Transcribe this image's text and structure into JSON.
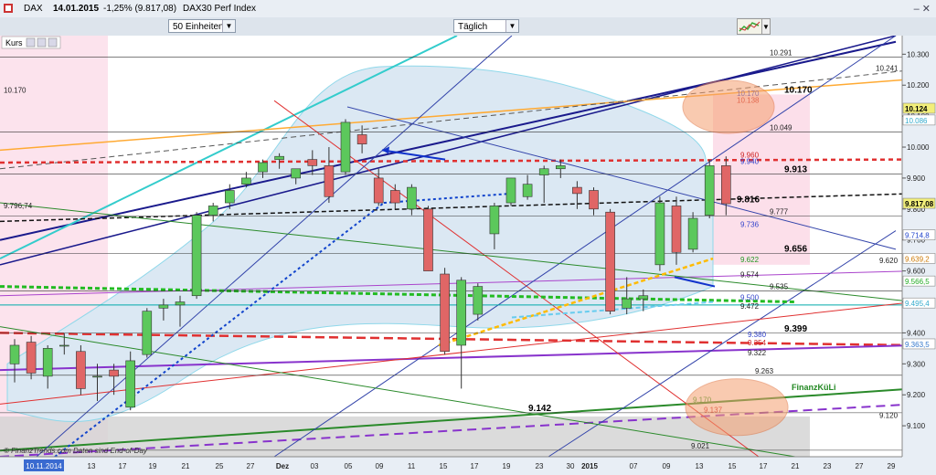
{
  "header": {
    "symbol": "DAX",
    "date": "14.01.2015",
    "change": "-1,25% (9.817,08)",
    "name": "DAX30 Perf Index",
    "window_controls": "– ✕"
  },
  "toolbar": {
    "units_value": "50 Einheiten",
    "period_value": "Täglich",
    "dropdown_arrow": "▼"
  },
  "panel": {
    "label": "Kurs"
  },
  "colors": {
    "up": "#5cc85c",
    "down": "#e06666",
    "price_box": "#f2ef7a",
    "band_fill": "#dbe8f3",
    "pink_zone": "#fbd7e5",
    "gray_zone": "#d2d2d2"
  },
  "chart_data": {
    "type": "candlestick",
    "y_axis": {
      "min": 9.0,
      "max": 10.36,
      "ticks": [
        "10.300",
        "10.200",
        "10.100",
        "10.000",
        "9.900",
        "9.800",
        "9.700",
        "9.600",
        "9.500",
        "9.400",
        "9.300",
        "9.200",
        "9.100"
      ]
    },
    "x_ticks": [
      "10.11.2014",
      "13",
      "17",
      "19",
      "21",
      "25",
      "27",
      "Dez",
      "03",
      "05",
      "09",
      "11",
      "15",
      "17",
      "19",
      "23",
      "30",
      "2015",
      "07",
      "09",
      "13",
      "15",
      "17",
      "21",
      "23",
      "27",
      "29"
    ],
    "candles": [
      {
        "date": "10.11.2014",
        "o": 9.3,
        "h": 9.38,
        "l": 9.24,
        "c": 9.36
      },
      {
        "date": "11.11.2014",
        "o": 9.37,
        "h": 9.39,
        "l": 9.25,
        "c": 9.27
      },
      {
        "date": "12.11.2014",
        "o": 9.26,
        "h": 9.36,
        "l": 9.22,
        "c": 9.35
      },
      {
        "date": "13.11.2014",
        "o": 9.36,
        "h": 9.4,
        "l": 9.33,
        "c": 9.36
      },
      {
        "date": "14.11.2014",
        "o": 9.34,
        "h": 9.36,
        "l": 9.2,
        "c": 9.22
      },
      {
        "date": "17.11.2014",
        "o": 9.26,
        "h": 9.3,
        "l": 9.18,
        "c": 9.26
      },
      {
        "date": "18.11.2014",
        "o": 9.28,
        "h": 9.3,
        "l": 9.2,
        "c": 9.26
      },
      {
        "date": "19.11.2014",
        "o": 9.16,
        "h": 9.34,
        "l": 9.15,
        "c": 9.31
      },
      {
        "date": "20.11.2014",
        "o": 9.33,
        "h": 9.48,
        "l": 9.32,
        "c": 9.47
      },
      {
        "date": "21.11.2014",
        "o": 9.48,
        "h": 9.51,
        "l": 9.44,
        "c": 9.49
      },
      {
        "date": "24.11.2014",
        "o": 9.49,
        "h": 9.52,
        "l": 9.42,
        "c": 9.5
      },
      {
        "date": "25.11.2014",
        "o": 9.52,
        "h": 9.79,
        "l": 9.51,
        "c": 9.78
      },
      {
        "date": "26.11.2014",
        "o": 9.78,
        "h": 9.82,
        "l": 9.76,
        "c": 9.81
      },
      {
        "date": "27.11.2014",
        "o": 9.82,
        "h": 9.88,
        "l": 9.8,
        "c": 9.86
      },
      {
        "date": "28.11.2014",
        "o": 9.88,
        "h": 9.92,
        "l": 9.87,
        "c": 9.9
      },
      {
        "date": "01.12.2014",
        "o": 9.92,
        "h": 9.96,
        "l": 9.9,
        "c": 9.95
      },
      {
        "date": "02.12.2014",
        "o": 9.96,
        "h": 9.98,
        "l": 9.93,
        "c": 9.97
      },
      {
        "date": "03.12.2014",
        "o": 9.9,
        "h": 9.93,
        "l": 9.88,
        "c": 9.93
      },
      {
        "date": "04.12.2014",
        "o": 9.96,
        "h": 9.99,
        "l": 9.91,
        "c": 9.94
      },
      {
        "date": "05.12.2014",
        "o": 9.94,
        "h": 10.0,
        "l": 9.82,
        "c": 9.84
      },
      {
        "date": "08.12.2014",
        "o": 9.92,
        "h": 10.09,
        "l": 9.91,
        "c": 10.08
      },
      {
        "date": "09.12.2014",
        "o": 10.04,
        "h": 10.07,
        "l": 9.98,
        "c": 10.01
      },
      {
        "date": "10.12.2014",
        "o": 9.9,
        "h": 9.93,
        "l": 9.81,
        "c": 9.82
      },
      {
        "date": "11.12.2014",
        "o": 9.86,
        "h": 9.88,
        "l": 9.8,
        "c": 9.82
      },
      {
        "date": "12.12.2014",
        "o": 9.8,
        "h": 9.88,
        "l": 9.78,
        "c": 9.87
      },
      {
        "date": "15.12.2014",
        "o": 9.8,
        "h": 9.81,
        "l": 9.6,
        "c": 9.6
      },
      {
        "date": "16.12.2014",
        "o": 9.59,
        "h": 9.61,
        "l": 9.33,
        "c": 9.34
      },
      {
        "date": "17.12.2014",
        "o": 9.36,
        "h": 9.58,
        "l": 9.22,
        "c": 9.57
      },
      {
        "date": "18.12.2014",
        "o": 9.46,
        "h": 9.56,
        "l": 9.44,
        "c": 9.55
      },
      {
        "date": "19.12.2014",
        "o": 9.72,
        "h": 9.82,
        "l": 9.67,
        "c": 9.81
      },
      {
        "date": "22.12.2014",
        "o": 9.82,
        "h": 9.9,
        "l": 9.81,
        "c": 9.9
      },
      {
        "date": "23.12.2014",
        "o": 9.84,
        "h": 9.91,
        "l": 9.83,
        "c": 9.88
      },
      {
        "date": "29.12.2014",
        "o": 9.91,
        "h": 9.94,
        "l": 9.82,
        "c": 9.93
      },
      {
        "date": "30.12.2014",
        "o": 9.93,
        "h": 9.96,
        "l": 9.9,
        "c": 9.94
      },
      {
        "date": "02.01.2015",
        "o": 9.87,
        "h": 9.89,
        "l": 9.8,
        "c": 9.85
      },
      {
        "date": "05.01.2015",
        "o": 9.86,
        "h": 9.87,
        "l": 9.78,
        "c": 9.8
      },
      {
        "date": "06.01.2015",
        "o": 9.79,
        "h": 9.8,
        "l": 9.46,
        "c": 9.47
      },
      {
        "date": "07.01.2015",
        "o": 9.48,
        "h": 9.58,
        "l": 9.46,
        "c": 9.51
      },
      {
        "date": "08.01.2015",
        "o": 9.51,
        "h": 9.54,
        "l": 9.47,
        "c": 9.52
      },
      {
        "date": "09.01.2015",
        "o": 9.62,
        "h": 9.84,
        "l": 9.6,
        "c": 9.82
      },
      {
        "date": "12.01.2015",
        "o": 9.81,
        "h": 9.84,
        "l": 9.62,
        "c": 9.66
      },
      {
        "date": "13.01.2015",
        "o": 9.67,
        "h": 9.79,
        "l": 9.66,
        "c": 9.77
      },
      {
        "date": "14.01.2015",
        "o": 9.78,
        "h": 9.96,
        "l": 9.77,
        "c": 9.94
      },
      {
        "date": "15.01.2015",
        "o": 9.94,
        "h": 9.97,
        "l": 9.78,
        "c": 9.817
      }
    ],
    "level_labels": [
      {
        "label": "10.291",
        "value": 10.291
      },
      {
        "label": "10.241",
        "value": 10.241
      },
      {
        "label": "10.170",
        "value": 10.17
      },
      {
        "label": "10.170",
        "value": 10.16
      },
      {
        "label": "10.138",
        "value": 10.138
      },
      {
        "label": "10.049",
        "value": 10.049
      },
      {
        "label": "9.960",
        "value": 9.96
      },
      {
        "label": "9.940",
        "value": 9.94
      },
      {
        "label": "9.913",
        "value": 9.913
      },
      {
        "label": "9.816",
        "value": 9.816
      },
      {
        "label": "9.796,74",
        "value": 9.796
      },
      {
        "label": "9.777",
        "value": 9.777
      },
      {
        "label": "9.736",
        "value": 9.736
      },
      {
        "label": "9.656",
        "value": 9.656
      },
      {
        "label": "9.622",
        "value": 9.622
      },
      {
        "label": "9.620",
        "value": 9.62
      },
      {
        "label": "9.574",
        "value": 9.574
      },
      {
        "label": "9.535",
        "value": 9.535
      },
      {
        "label": "9.500",
        "value": 9.5
      },
      {
        "label": "9.472",
        "value": 9.472
      },
      {
        "label": "9.399",
        "value": 9.399
      },
      {
        "label": "9.380",
        "value": 9.38
      },
      {
        "label": "9.354",
        "value": 9.354
      },
      {
        "label": "9.322",
        "value": 9.322
      },
      {
        "label": "9.263",
        "value": 9.263
      },
      {
        "label": "9.170",
        "value": 9.17
      },
      {
        "label": "9.142",
        "value": 9.142
      },
      {
        "label": "9.137",
        "value": 9.137
      },
      {
        "label": "9.120",
        "value": 9.12
      },
      {
        "label": "9.021",
        "value": 9.021
      }
    ],
    "price_boxes": [
      {
        "label": "10.124",
        "value": 10.124
      },
      {
        "label": "10.086",
        "value": 10.086
      },
      {
        "label": "9.817,08",
        "value": 9.817
      },
      {
        "label": "9.714,8",
        "value": 9.715
      },
      {
        "label": "9.639,2",
        "value": 9.639
      },
      {
        "label": "9.566,5",
        "value": 9.566
      },
      {
        "label": "9.495,4",
        "value": 9.495
      },
      {
        "label": "9.363,5",
        "value": 9.363
      }
    ],
    "annotation": "FinanzKüLi",
    "watermark": "© FinanzTrends.com  Daten sind End-of-Day"
  }
}
